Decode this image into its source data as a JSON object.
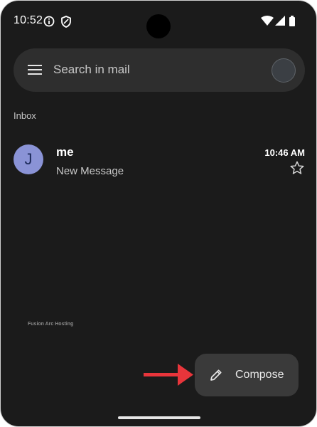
{
  "status_bar": {
    "time": "10:52",
    "icons": [
      "info-icon",
      "shield-icon",
      "wifi-icon",
      "signal-icon",
      "battery-icon"
    ]
  },
  "search": {
    "placeholder": "Search in mail",
    "menu_icon": "menu-icon"
  },
  "mailbox": {
    "label": "Inbox"
  },
  "emails": [
    {
      "avatar_letter": "J",
      "sender": "me",
      "subject": "New Message",
      "time": "10:46 AM",
      "starred": false
    }
  ],
  "watermark": "Fusion Arc Hosting",
  "compose": {
    "label": "Compose"
  },
  "colors": {
    "background": "#1b1b1b",
    "search_bar": "#2e2e2e",
    "avatar": "#8a93d6",
    "compose_button": "#3a3a3a",
    "annotation_arrow": "#e8353b"
  }
}
